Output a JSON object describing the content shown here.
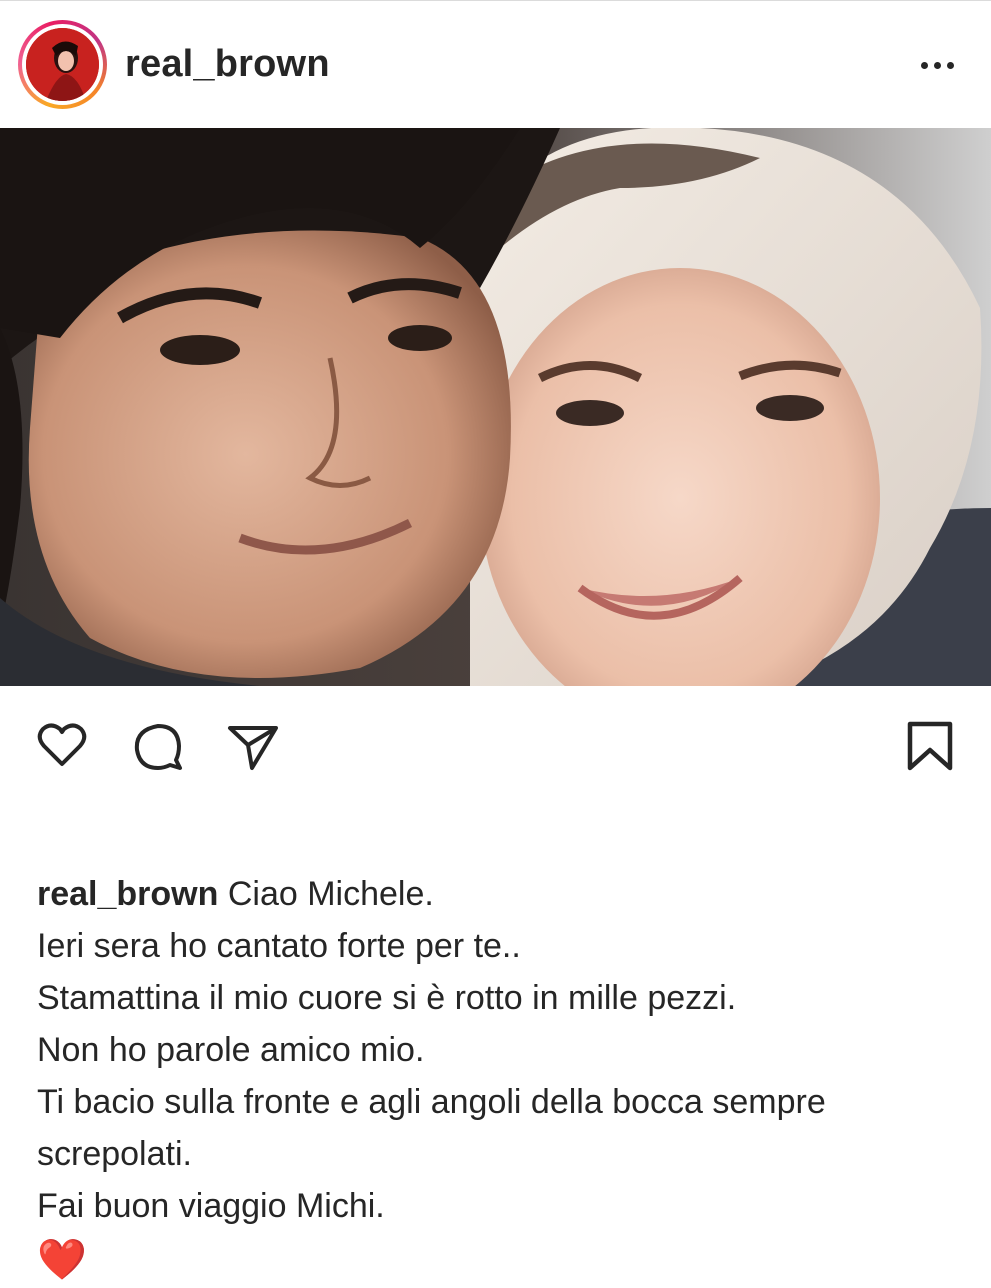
{
  "post": {
    "username": "real_brown",
    "more_icon": "more-horizontal-icon",
    "photo_description_hidden": "",
    "actions": {
      "like_icon": "heart-outline-icon",
      "comment_icon": "comment-icon",
      "share_icon": "send-icon",
      "save_icon": "bookmark-icon"
    },
    "caption": {
      "username": "real_brown",
      "first_line": "Ciao Michele.",
      "lines": [
        "Ieri sera ho cantato forte per te..",
        "Stamattina il mio cuore si è rotto in mille pezzi.",
        "Non ho parole amico mio.",
        "Ti bacio sulla fronte e agli angoli della bocca sempre",
        "screpolati.",
        "Fai buon viaggio Michi."
      ],
      "emoji": "❤️"
    }
  },
  "colors": {
    "text": "#262626",
    "heart_emoji": "#e53935",
    "story_ring_start": "#f9a825",
    "story_ring_end": "#c13584"
  }
}
